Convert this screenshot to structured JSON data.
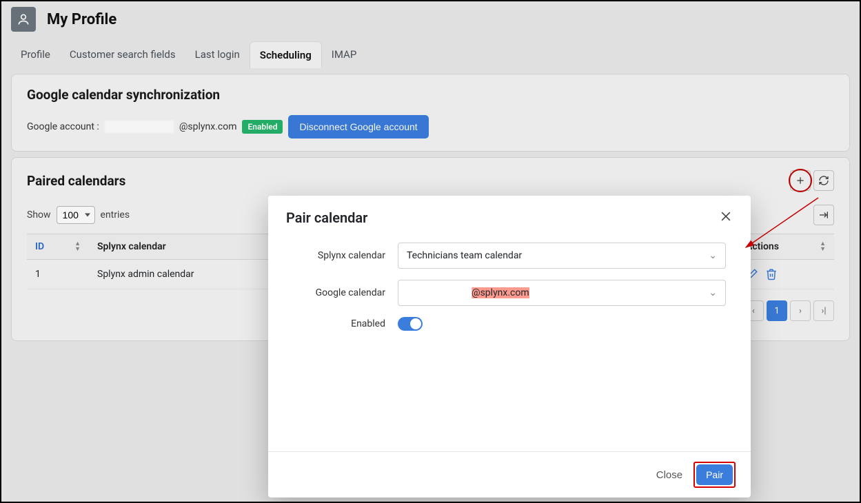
{
  "header": {
    "title": "My Profile"
  },
  "tabs": {
    "items": [
      {
        "label": "Profile"
      },
      {
        "label": "Customer search fields"
      },
      {
        "label": "Last login"
      },
      {
        "label": "Scheduling"
      },
      {
        "label": "IMAP"
      }
    ],
    "active_index": 3
  },
  "sync_card": {
    "title": "Google calendar synchronization",
    "account_label": "Google account :",
    "account_domain": "@splynx.com",
    "enabled_badge": "Enabled",
    "disconnect_label": "Disconnect Google account"
  },
  "paired_card": {
    "title": "Paired calendars",
    "show_label": "Show",
    "entries_label": "entries",
    "page_size": "100",
    "columns": {
      "id": "ID",
      "splynx": "Splynx calendar",
      "actions": "Actions"
    },
    "rows": [
      {
        "id": "1",
        "splynx": "Splynx admin calendar"
      }
    ],
    "page_current": "1"
  },
  "modal": {
    "title": "Pair calendar",
    "labels": {
      "splynx": "Splynx calendar",
      "google": "Google calendar",
      "enabled": "Enabled"
    },
    "values": {
      "splynx": "Technicians team calendar",
      "google_suffix": "@splynx.com"
    },
    "buttons": {
      "close": "Close",
      "pair": "Pair"
    }
  }
}
